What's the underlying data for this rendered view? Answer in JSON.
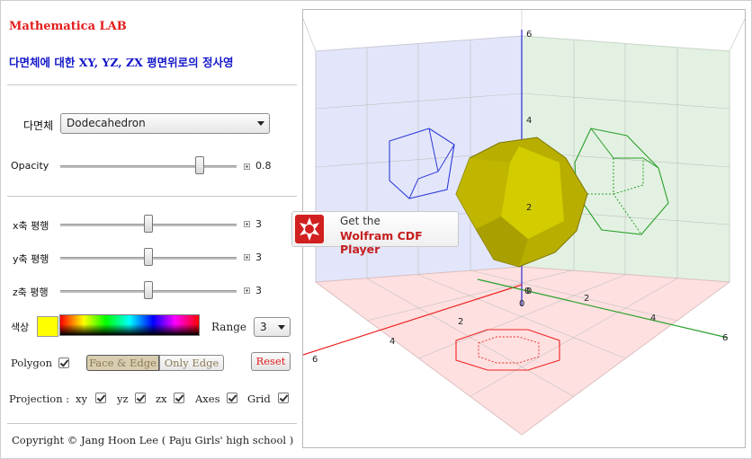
{
  "app": {
    "title": "Mathematica LAB",
    "subtitle": "다면체에 대한 XY, YZ, ZX 평면위로의 정사영"
  },
  "polyhedron": {
    "label": "다면체",
    "selected": "Dodecahedron"
  },
  "opacity": {
    "label": "Opacity",
    "value": "0.8",
    "fraction": 0.8
  },
  "shifts": [
    {
      "label": "x축 평행",
      "value": "3",
      "fraction": 0.5
    },
    {
      "label": "y축 평행",
      "value": "3",
      "fraction": 0.5
    },
    {
      "label": "z축 평행",
      "value": "3",
      "fraction": 0.5
    }
  ],
  "color": {
    "label": "색상",
    "swatch": "#ffff00"
  },
  "range": {
    "label": "Range",
    "selected": "3"
  },
  "polygon": {
    "label": "Polygon",
    "checked": true,
    "face_edge_label": "Face & Edge",
    "only_edge_label": "Only Edge",
    "reset_label": "Reset"
  },
  "projection": {
    "label": "Projection :",
    "options": [
      {
        "label": "xy",
        "checked": true
      },
      {
        "label": "yz",
        "checked": true
      },
      {
        "label": "zx",
        "checked": true
      },
      {
        "label": "Axes",
        "checked": true
      },
      {
        "label": "Grid",
        "checked": true
      }
    ]
  },
  "copyright": "Copyright © Jang Hoon Lee ( Paju Girls' high school )",
  "cdf_badge": {
    "line1": "Get the",
    "line2": "Wolfram CDF Player"
  },
  "axis_ticks": {
    "z": [
      "6",
      "4",
      "2",
      "0"
    ],
    "x": [
      "0",
      "2",
      "4",
      "6"
    ],
    "y": [
      "0",
      "2",
      "4",
      "6"
    ]
  },
  "colors": {
    "title": "#e31b1b",
    "subtitle": "#1418c8",
    "xy_plane": "#ffe0e0",
    "yz_plane": "#e3e6fb",
    "zx_plane": "#e3f1e3",
    "solid": "#c8c000"
  }
}
